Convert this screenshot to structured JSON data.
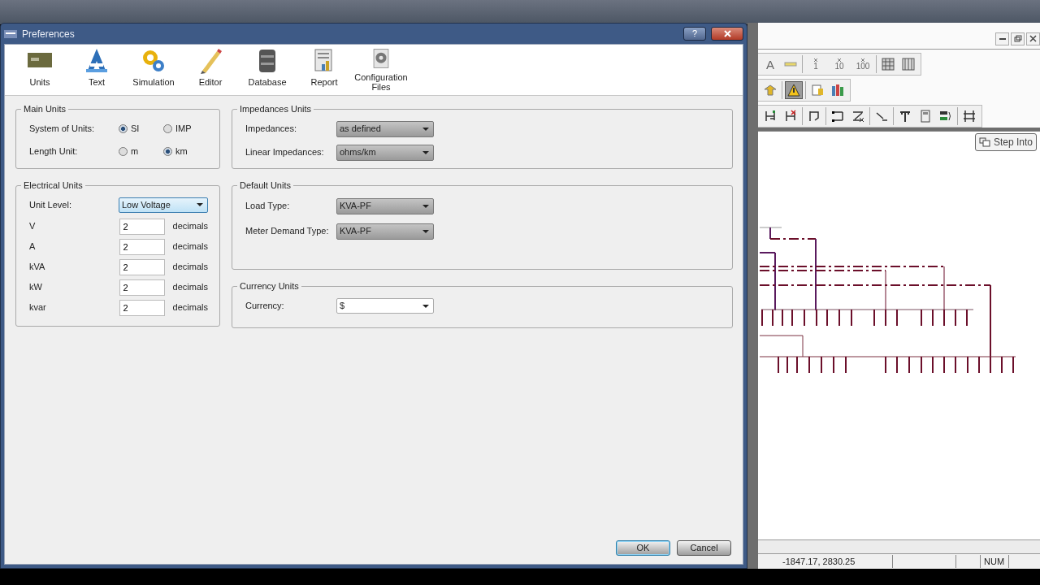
{
  "dialog": {
    "title": "Preferences",
    "help_button": "?",
    "categories": [
      {
        "label": "Units"
      },
      {
        "label": "Text"
      },
      {
        "label": "Simulation"
      },
      {
        "label": "Editor"
      },
      {
        "label": "Database"
      },
      {
        "label": "Report"
      },
      {
        "label": "Configuration Files"
      }
    ],
    "main_units": {
      "title": "Main Units",
      "rows": [
        {
          "label": "System of Units:",
          "options": [
            {
              "label": "SI",
              "selected": true
            },
            {
              "label": "IMP",
              "selected": false
            }
          ]
        },
        {
          "label": "Length Unit:",
          "options": [
            {
              "label": "m",
              "selected": false
            },
            {
              "label": "km",
              "selected": true
            }
          ]
        }
      ]
    },
    "electrical_units": {
      "title": "Electrical Units",
      "unit_level": {
        "label": "Unit Level:",
        "value": "Low Voltage",
        "hovered": true
      },
      "rows": [
        {
          "label": "V",
          "value": "2",
          "suffix": "decimals"
        },
        {
          "label": "A",
          "value": "2",
          "suffix": "decimals"
        },
        {
          "label": "kVA",
          "value": "2",
          "suffix": "decimals"
        },
        {
          "label": "kW",
          "value": "2",
          "suffix": "decimals"
        },
        {
          "label": "kvar",
          "value": "2",
          "suffix": "decimals"
        }
      ]
    },
    "impedances_units": {
      "title": "Impedances Units",
      "fields": [
        {
          "label": "Impedances:",
          "value": "as defined",
          "disabled": true
        },
        {
          "label": "Linear Impedances:",
          "value": "ohms/km",
          "disabled": true
        }
      ]
    },
    "default_units": {
      "title": "Default Units",
      "fields": [
        {
          "label": "Load Type:",
          "value": "KVA-PF",
          "disabled": true
        },
        {
          "label": "Meter Demand Type:",
          "value": "KVA-PF",
          "disabled": true
        }
      ]
    },
    "currency_units": {
      "title": "Currency Units",
      "fields": [
        {
          "label": "Currency:",
          "value": "$",
          "disabled": false
        }
      ]
    },
    "buttons": [
      {
        "label": "OK",
        "default": true
      },
      {
        "label": "Cancel",
        "default": false
      }
    ]
  },
  "app": {
    "step_into": "Step Into",
    "toolbars": [
      [
        {
          "kind": "text",
          "text": "A",
          "pressed": false
        },
        {
          "kind": "icon",
          "pressed": false
        },
        {
          "kind": "separator"
        },
        {
          "kind": "zoom",
          "text": "1",
          "pressed": false
        },
        {
          "kind": "zoom",
          "text": "10",
          "pressed": false
        },
        {
          "kind": "zoom",
          "text": "100",
          "pressed": false
        },
        {
          "kind": "separator"
        },
        {
          "kind": "icon",
          "pressed": false
        },
        {
          "kind": "icon",
          "pressed": false
        }
      ],
      [
        {
          "kind": "icon",
          "pressed": false
        },
        {
          "kind": "separator"
        },
        {
          "kind": "icon",
          "pressed": true
        },
        {
          "kind": "separator"
        },
        {
          "kind": "icon",
          "pressed": false
        },
        {
          "kind": "icon",
          "pressed": false
        }
      ],
      [
        {
          "kind": "icon",
          "pressed": false
        },
        {
          "kind": "icon",
          "pressed": false
        },
        {
          "kind": "separator"
        },
        {
          "kind": "icon",
          "pressed": false
        },
        {
          "kind": "separator"
        },
        {
          "kind": "icon",
          "pressed": false
        },
        {
          "kind": "icon",
          "pressed": false
        },
        {
          "kind": "separator"
        },
        {
          "kind": "icon",
          "pressed": false
        },
        {
          "kind": "separator"
        },
        {
          "kind": "icon",
          "pressed": false
        },
        {
          "kind": "icon",
          "pressed": false
        },
        {
          "kind": "icon",
          "pressed": false
        },
        {
          "kind": "separator"
        },
        {
          "kind": "icon",
          "pressed": false
        }
      ]
    ],
    "status_bar": [
      {
        "text": "-1847.17, 2830.25"
      },
      {
        "text": "NUM"
      }
    ]
  }
}
